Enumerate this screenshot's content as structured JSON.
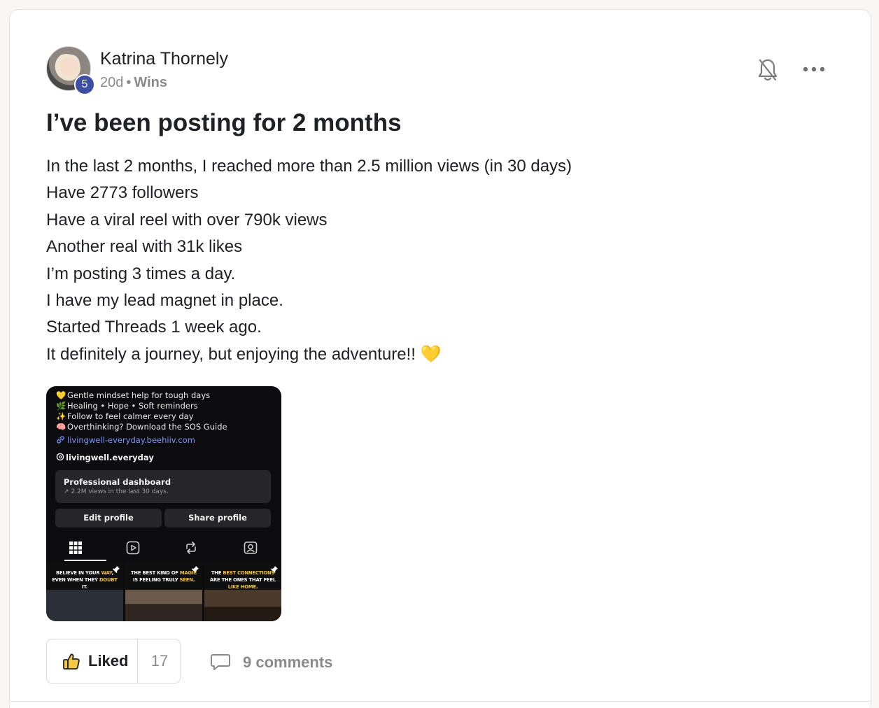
{
  "author": {
    "name": "Katrina Thornely",
    "level": "5",
    "time_ago": "20d",
    "separator": "•",
    "category": "Wins"
  },
  "post": {
    "title": "I’ve been posting for 2 months",
    "lines": [
      "In the last 2 months, I reached more than 2.5 million views (in 30 days)",
      "Have 2773 followers",
      "Have a viral reel with over 790k views",
      "Another real with 31k likes",
      "I’m posting 3 times a day.",
      "I have my lead magnet in place.",
      "Started Threads 1 week ago.",
      "It definitely a journey, but enjoying the adventure!!"
    ],
    "last_line_emoji": "💛"
  },
  "image": {
    "bio": [
      {
        "emoji": "💛",
        "text": "Gentle mindset help for tough days"
      },
      {
        "emoji": "🌿",
        "text": "Healing • Hope • Soft reminders"
      },
      {
        "emoji": "✨",
        "text": "Follow to feel calmer every day"
      },
      {
        "emoji": "🧠",
        "text": "Overthinking? Download the SOS Guide"
      }
    ],
    "link": "livingwell-everyday.beehiiv.com",
    "handle": "livingwell.everyday",
    "dashboard_title": "Professional dashboard",
    "dashboard_sub": "↗ 2.2M views in the last 30 days.",
    "edit_profile": "Edit profile",
    "share_profile": "Share profile",
    "thumbs": [
      {
        "pre": "BELIEVE IN YOUR ",
        "hl": "WAY",
        "post": ", EVEN WHEN THEY ",
        "hl2": "DOUBT",
        "post2": " IT."
      },
      {
        "pre": "THE BEST KIND OF ",
        "hl": "MAGIC",
        "post": " IS FEELING TRULY ",
        "hl2": "SEEN",
        "post2": "."
      },
      {
        "pre": "THE ",
        "hl": "BEST CONNECTIONS",
        "post": " ARE THE ONES THAT FEEL ",
        "hl2": "LIKE HOME",
        "post2": "."
      }
    ]
  },
  "actions": {
    "like_label": "Liked",
    "like_count": "17",
    "comments_label": "9 comments"
  },
  "icons": [
    "bell-off-icon",
    "more-icon",
    "thumbs-up-icon",
    "comment-icon",
    "grid-icon",
    "reels-icon",
    "repost-icon",
    "tagged-icon",
    "link-icon",
    "threads-icon",
    "pin-icon"
  ],
  "colors": {
    "badge": "#3c4fa3",
    "muted": "#8a8a8a",
    "link": "#7d94ff",
    "thumb_highlight": "#f0c24b"
  }
}
